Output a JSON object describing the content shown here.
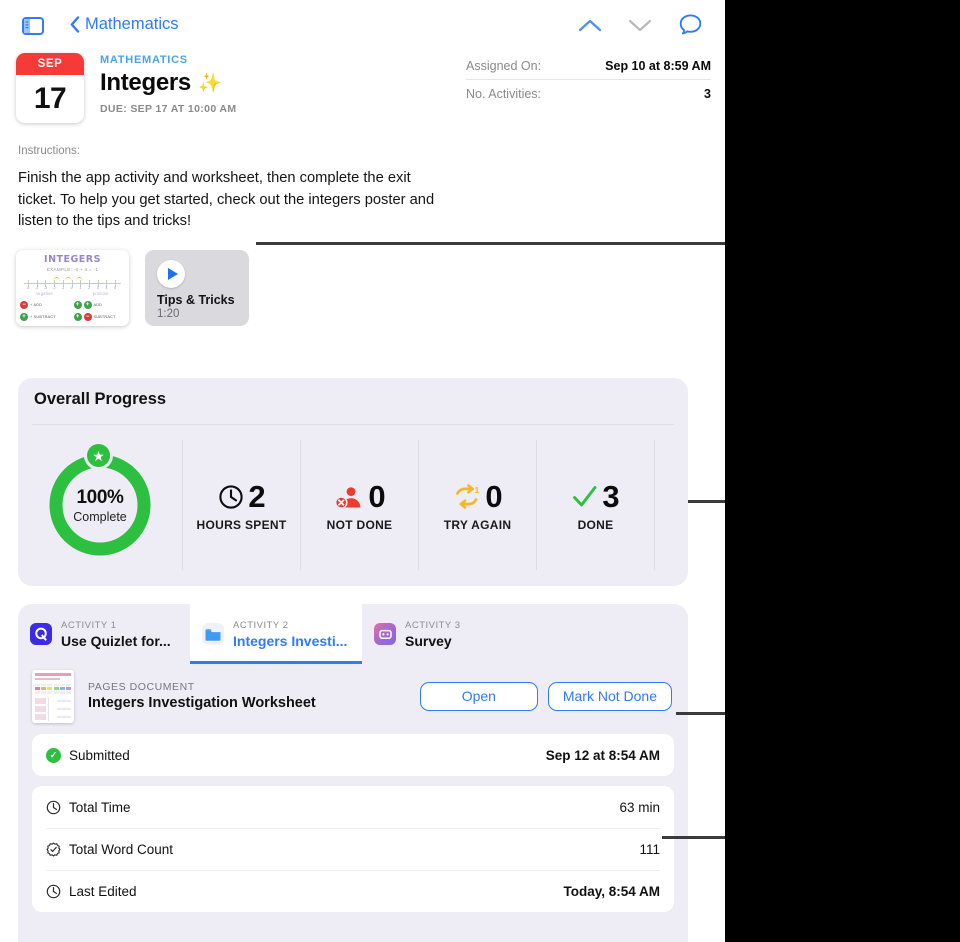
{
  "navbar": {
    "sidebar_toggle_icon": "sidebar-toggle-icon",
    "back_label": "Mathematics",
    "up_icon": "chevron-up-icon",
    "down_icon": "chevron-down-icon",
    "comment_icon": "comment-bubble-icon",
    "accent_blue": "#2f7cf6",
    "inactive_gray": "#b8b8bd"
  },
  "header": {
    "calendar": {
      "month": "SEP",
      "day": "17",
      "month_bg": "#f63a37"
    },
    "subject": "MATHEMATICS",
    "title": "Integers",
    "title_emoji": "✨",
    "due": "DUE: SEP 17 AT 10:00 AM"
  },
  "meta": {
    "rows": [
      {
        "key": "Assigned On:",
        "value": "Sep 10 at 8:59 AM"
      },
      {
        "key": "No. Activities:",
        "value": "3"
      }
    ]
  },
  "instructions": {
    "label": "Instructions:",
    "body": "Finish the app activity and worksheet, then complete the exit ticket. To help you get started, check out the integers poster and listen to the tips and tricks!"
  },
  "attachments": {
    "poster": {
      "name": "integers-poster-thumbnail",
      "title": "INTEGERS",
      "example": "EXAMPLE: -5 + 4 = -1",
      "numbers": [
        "-5",
        "-4",
        "-3",
        "-2",
        "-1",
        "0",
        "1",
        "2",
        "3",
        "4",
        "5"
      ],
      "sub_left": "negative",
      "sub_right": "positive",
      "rows": [
        {
          "left_sign": "−",
          "left_text": "+ ADD",
          "right_sign_a": "+",
          "right_sign_b": "+",
          "right_text": "ADD"
        },
        {
          "left_sign": "+",
          "left_text": "+ SUBTRACT",
          "right_sign_a": "+",
          "right_sign_b": "−",
          "right_text": "SUBTRACT"
        }
      ]
    },
    "video": {
      "name": "tips-and-tricks-video",
      "title": "Tips & Tricks",
      "duration": "1:20",
      "play_icon": "play-icon"
    }
  },
  "progress": {
    "title": "Overall Progress",
    "ring": {
      "percent_label": "100%",
      "sub_label": "Complete",
      "percent_value": 100,
      "color": "#2dbf3f",
      "badge_icon": "star-icon"
    },
    "stats": [
      {
        "icon": "clock-icon",
        "value": "2",
        "label": "HOURS SPENT",
        "icon_color": "#0c0c0c"
      },
      {
        "icon": "not-done-person-icon",
        "value": "0",
        "label": "NOT DONE",
        "icon_color": "#ef3b2d"
      },
      {
        "icon": "try-again-loop-icon",
        "value": "0",
        "label": "TRY AGAIN",
        "icon_color": "#f5b察"
      },
      {
        "icon": "checkmark-icon",
        "value": "3",
        "label": "DONE",
        "icon_color": "#2dbf3f"
      }
    ]
  },
  "activities": {
    "tabs": [
      {
        "kicker": "ACTIVITY 1",
        "name": "Use Quizlet for...",
        "icon": "quizlet-app-icon",
        "active": false
      },
      {
        "kicker": "ACTIVITY 2",
        "name": "Integers Investi...",
        "icon": "folder-document-icon",
        "active": true
      },
      {
        "kicker": "ACTIVITY 3",
        "name": "Survey",
        "icon": "survey-app-icon",
        "active": false
      }
    ],
    "document": {
      "thumbnail_name": "pages-document-thumbnail",
      "kicker": "PAGES DOCUMENT",
      "name": "Integers Investigation Worksheet",
      "open_label": "Open",
      "mark_not_done_label": "Mark Not Done"
    },
    "status": {
      "icon": "submitted-check-icon",
      "label": "Submitted",
      "value": "Sep 12 at 8:54 AM"
    },
    "details": [
      {
        "icon": "clock-icon",
        "label": "Total Time",
        "value": "63 min"
      },
      {
        "icon": "word-count-icon",
        "label": "Total Word Count",
        "value": "111"
      },
      {
        "icon": "clock-icon",
        "label": "Last Edited",
        "value": "Today, 8:54 AM"
      }
    ]
  }
}
